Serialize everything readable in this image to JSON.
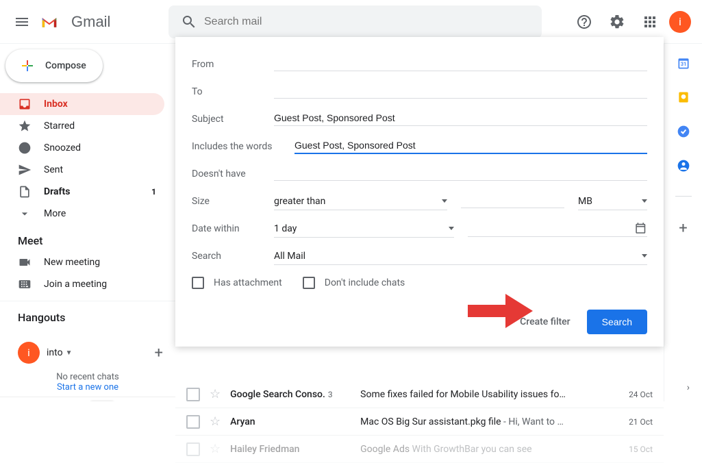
{
  "header": {
    "app_name": "Gmail",
    "search_placeholder": "Search mail",
    "avatar_initial": "i"
  },
  "sidebar": {
    "compose_label": "Compose",
    "nav": [
      {
        "label": "Inbox",
        "icon": "inbox",
        "active": true
      },
      {
        "label": "Starred",
        "icon": "star"
      },
      {
        "label": "Snoozed",
        "icon": "clock"
      },
      {
        "label": "Sent",
        "icon": "send"
      },
      {
        "label": "Drafts",
        "icon": "file",
        "count": "1"
      },
      {
        "label": "More",
        "icon": "chevron"
      }
    ],
    "meet_title": "Meet",
    "meet_items": [
      {
        "label": "New meeting"
      },
      {
        "label": "Join a meeting"
      }
    ],
    "hangouts_title": "Hangouts",
    "hangouts_user": "into",
    "hangouts_initial": "i",
    "no_chats": "No recent chats",
    "start_new": "Start a new one"
  },
  "filter": {
    "from_label": "From",
    "to_label": "To",
    "subject_label": "Subject",
    "subject_value": "Guest Post, Sponsored Post",
    "includes_label": "Includes the words",
    "includes_value": "Guest Post, Sponsored Post",
    "doesnt_label": "Doesn't have",
    "size_label": "Size",
    "size_op": "greater than",
    "size_unit": "MB",
    "date_label": "Date within",
    "date_value": "1 day",
    "search_label": "Search",
    "search_scope": "All Mail",
    "has_attachment": "Has attachment",
    "no_chats": "Don't include chats",
    "create_filter": "Create filter",
    "search_btn": "Search"
  },
  "mails": [
    {
      "sender": "Google Search Conso.",
      "count": "3",
      "subject": "Some fixes failed for Mobile Usability issues fo…",
      "snippet": "",
      "date": "24 Oct"
    },
    {
      "sender": "Aryan",
      "count": "",
      "subject": "Mac OS Big Sur assistant.pkg file",
      "snippet": " - Hi, Want to …",
      "date": "21 Oct"
    },
    {
      "sender": "Hailey Friedman",
      "count": "",
      "subject": "Google Ads",
      "snippet": " With GrowthBar you can see",
      "date": "15 Oct"
    }
  ]
}
